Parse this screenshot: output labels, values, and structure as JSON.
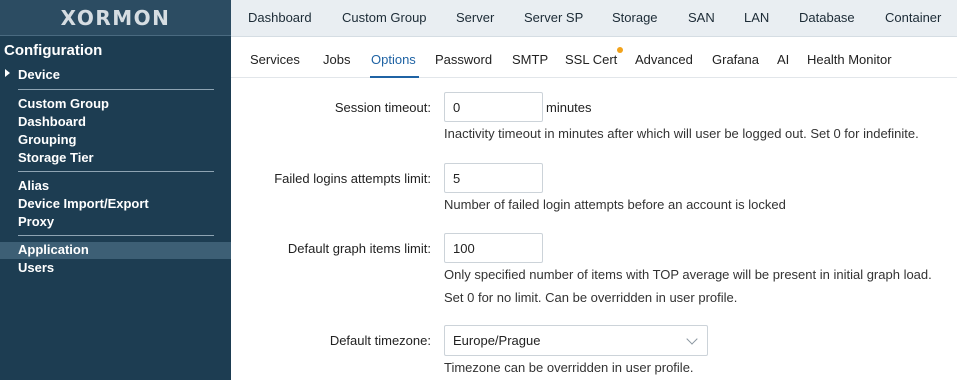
{
  "sidebar": {
    "logo": "XORMON",
    "section": "Configuration",
    "device": "Device",
    "group1": [
      "Custom Group",
      "Dashboard",
      "Grouping",
      "Storage Tier"
    ],
    "group2": [
      "Alias",
      "Device Import/Export",
      "Proxy"
    ],
    "group3": [
      "Application",
      "Users"
    ],
    "active": "Application"
  },
  "topnav": [
    "Dashboard",
    "Custom Group",
    "Server",
    "Server SP",
    "Storage",
    "SAN",
    "LAN",
    "Database",
    "Container"
  ],
  "subtabs": [
    "Services",
    "Jobs",
    "Options",
    "Password",
    "SMTP",
    "SSL Cert",
    "Advanced",
    "Grafana",
    "AI",
    "Health Monitor"
  ],
  "active_tab": "Options",
  "form": {
    "session_timeout": {
      "label": "Session timeout",
      "value": "0",
      "unit": "minutes",
      "help": "Inactivity timeout in minutes after which will user be logged out. Set 0 for indefinite."
    },
    "failed_logins": {
      "label": "Failed logins attempts limit",
      "value": "5",
      "help": "Number of failed login attempts before an account is locked"
    },
    "graph_items": {
      "label": "Default graph items limit",
      "value": "100",
      "help1": "Only specified number of items with TOP average will be present in initial graph load.",
      "help2": "Set 0 for no limit. Can be overridden in user profile."
    },
    "timezone": {
      "label": "Default timezone",
      "value": "Europe/Prague",
      "help": "Timezone can be overridden in user profile."
    }
  },
  "colors": {
    "sidebar": "#1d3d52",
    "accent": "#1f63a4",
    "notify_dot": "#f2a31b"
  }
}
